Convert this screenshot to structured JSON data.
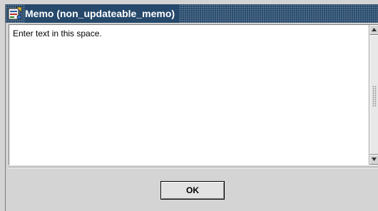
{
  "window": {
    "title": "Memo (non_updateable_memo)",
    "title_icon": "form-icon"
  },
  "memo": {
    "text": "Enter text in this space."
  },
  "footer": {
    "ok_label": "OK"
  },
  "colors": {
    "titlebar": "#26496b",
    "background": "#d4d4d4",
    "memo_background": "#ffffff"
  }
}
